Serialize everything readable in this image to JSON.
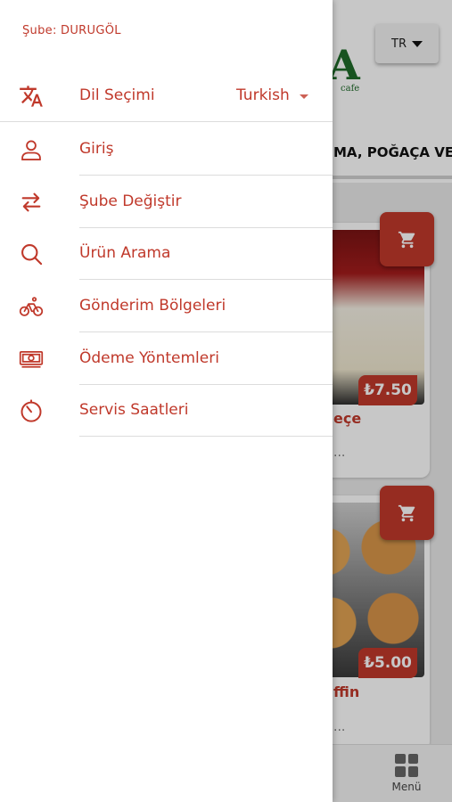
{
  "background": {
    "lang_button": "TR",
    "logo": {
      "letter": "A",
      "sub": "cafe"
    },
    "category_title": "MA, POĞAÇA VE",
    "products": [
      {
        "name": "eçe",
        "price": "₺7.50",
        "dots": "..."
      },
      {
        "name": "ffin",
        "price": "₺5.00",
        "dots": "..."
      }
    ],
    "bottom_nav": {
      "menu_label": "Menü"
    }
  },
  "drawer": {
    "branch_label": "Şube: DURUGÖL",
    "language": {
      "label": "Dil Seçimi",
      "value": "Turkish",
      "icon": "translate-icon"
    },
    "items": [
      {
        "label": "Giriş",
        "icon": "user-icon"
      },
      {
        "label": "Şube Değiştir",
        "icon": "swap-icon"
      },
      {
        "label": "Ürün Arama",
        "icon": "search-icon"
      },
      {
        "label": "Gönderim Bölgeleri",
        "icon": "bicycle-icon"
      },
      {
        "label": "Ödeme Yöntemleri",
        "icon": "money-icon"
      },
      {
        "label": "Servis Saatleri",
        "icon": "timer-icon"
      }
    ]
  },
  "colors": {
    "accent": "#c0392b",
    "text_dark": "#111111",
    "separator": "#dcdcdc"
  }
}
